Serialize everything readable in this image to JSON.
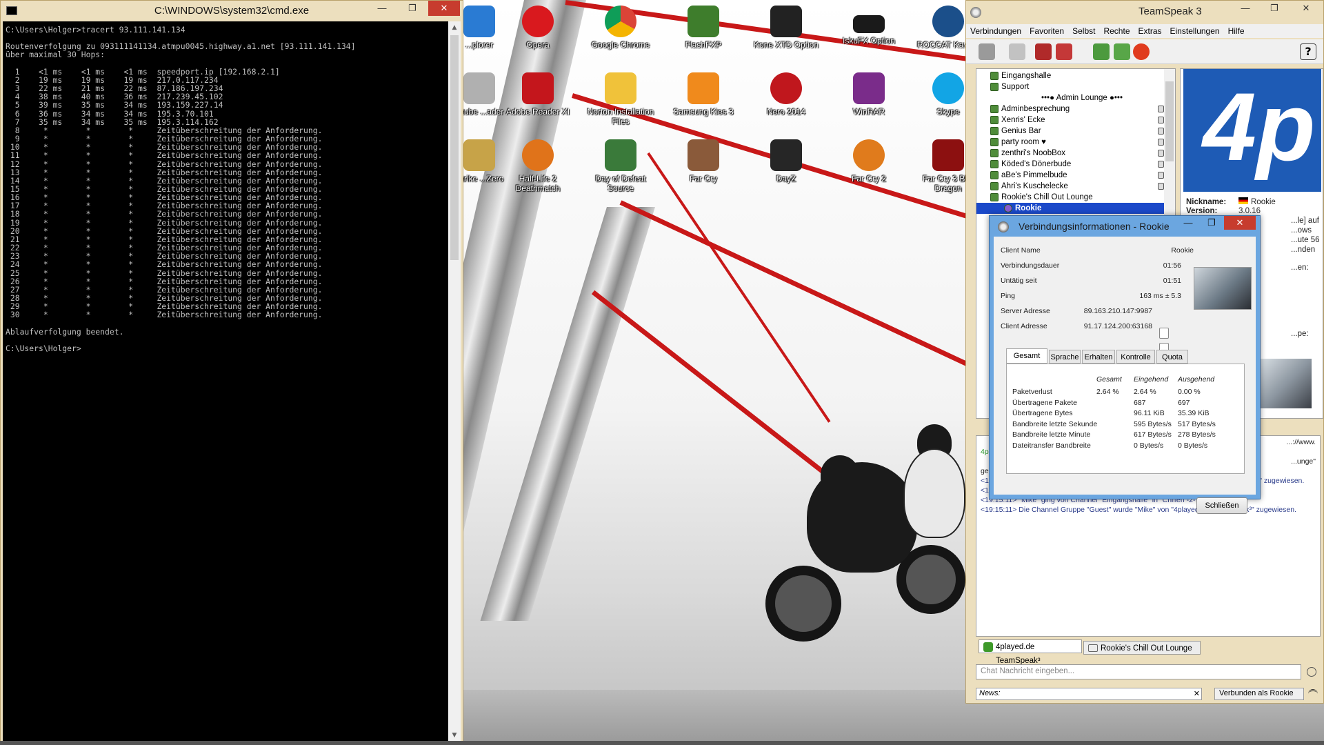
{
  "colors": {
    "accent_blue": "#1b49c9",
    "cable_red": "#c81818",
    "cmd_text": "#c0c0c0",
    "dialog_frame": "#6ba6e0"
  },
  "cmd": {
    "title": "C:\\WINDOWS\\system32\\cmd.exe",
    "lines": [
      "C:\\Users\\Holger>tracert 93.111.141.134",
      "",
      "Routenverfolgung zu 093111141134.atmpu0045.highway.a1.net [93.111.141.134]",
      "über maximal 30 Hops:",
      "",
      "  1    <1 ms    <1 ms    <1 ms  speedport.ip [192.168.2.1]",
      "  2    19 ms    19 ms    19 ms  217.0.117.234",
      "  3    22 ms    21 ms    22 ms  87.186.197.234",
      "  4    38 ms    40 ms    36 ms  217.239.45.102",
      "  5    39 ms    35 ms    34 ms  193.159.227.14",
      "  6    36 ms    34 ms    34 ms  195.3.70.101",
      "  7    35 ms    34 ms    35 ms  195.3.114.162",
      "  8     *        *        *     Zeitüberschreitung der Anforderung.",
      "  9     *        *        *     Zeitüberschreitung der Anforderung.",
      " 10     *        *        *     Zeitüberschreitung der Anforderung.",
      " 11     *        *        *     Zeitüberschreitung der Anforderung.",
      " 12     *        *        *     Zeitüberschreitung der Anforderung.",
      " 13     *        *        *     Zeitüberschreitung der Anforderung.",
      " 14     *        *        *     Zeitüberschreitung der Anforderung.",
      " 15     *        *        *     Zeitüberschreitung der Anforderung.",
      " 16     *        *        *     Zeitüberschreitung der Anforderung.",
      " 17     *        *        *     Zeitüberschreitung der Anforderung.",
      " 18     *        *        *     Zeitüberschreitung der Anforderung.",
      " 19     *        *        *     Zeitüberschreitung der Anforderung.",
      " 20     *        *        *     Zeitüberschreitung der Anforderung.",
      " 21     *        *        *     Zeitüberschreitung der Anforderung.",
      " 22     *        *        *     Zeitüberschreitung der Anforderung.",
      " 23     *        *        *     Zeitüberschreitung der Anforderung.",
      " 24     *        *        *     Zeitüberschreitung der Anforderung.",
      " 25     *        *        *     Zeitüberschreitung der Anforderung.",
      " 26     *        *        *     Zeitüberschreitung der Anforderung.",
      " 27     *        *        *     Zeitüberschreitung der Anforderung.",
      " 28     *        *        *     Zeitüberschreitung der Anforderung.",
      " 29     *        *        *     Zeitüberschreitung der Anforderung.",
      " 30     *        *        *     Zeitüberschreitung der Anforderung.",
      "",
      "Ablaufverfolgung beendet.",
      "",
      "C:\\Users\\Holger>"
    ]
  },
  "desktop_icons": [
    {
      "label": "...plorer",
      "color": "#2a7bd3"
    },
    {
      "label": "Opera",
      "color": "#d9191e"
    },
    {
      "label": "Google Chrome",
      "color": "#2f9e44"
    },
    {
      "label": "FlashFXP",
      "color": "#3e7d2c"
    },
    {
      "label": "Kone XTD Option",
      "color": "#222222"
    },
    {
      "label": "IskuFX Option",
      "color": "#1a1a1a"
    },
    {
      "label": "ROCCAT Kave...",
      "color": "#1b4f8a"
    },
    {
      "label": "...tube ...ader",
      "color": "#b0b0b0"
    },
    {
      "label": "Adobe Reader XI",
      "color": "#c4161c"
    },
    {
      "label": "Norton Installation Files",
      "color": "#f0c23a"
    },
    {
      "label": "Samsung Kies 3",
      "color": "#f08a1c"
    },
    {
      "label": "Nero 2014",
      "color": "#c0171d"
    },
    {
      "label": "WinRAR",
      "color": "#7a2c8a"
    },
    {
      "label": "Skype",
      "color": "#12a5e5"
    },
    {
      "label": "...trike ...Zero",
      "color": "#c7a348"
    },
    {
      "label": "Half-Life 2 Deathmatch",
      "color": "#e0731a"
    },
    {
      "label": "Day of Defeat Source",
      "color": "#3a7a3a"
    },
    {
      "label": "Far Cry",
      "color": "#8a5a3a"
    },
    {
      "label": "DayZ",
      "color": "#262626"
    },
    {
      "label": "Far Cry 2",
      "color": "#e07b1c"
    },
    {
      "label": "Far Cry 3 Bl... Dragon",
      "color": "#8c1010"
    }
  ],
  "teamspeak": {
    "title": "TeamSpeak 3",
    "menu": [
      "Verbindungen",
      "Favoriten",
      "Selbst",
      "Rechte",
      "Extras",
      "Einstellungen",
      "Hilfe"
    ],
    "channels": [
      {
        "label": "Eingangshalle",
        "locked": false
      },
      {
        "label": "Support",
        "locked": false
      },
      {
        "label": "•••● Admin Lounge ●•••",
        "locked": false,
        "spacer": true
      },
      {
        "label": "Adminbesprechung",
        "locked": true
      },
      {
        "label": "Xenris' Ecke",
        "locked": true
      },
      {
        "label": "Genius Bar",
        "locked": true
      },
      {
        "label": "party room ♥",
        "locked": true
      },
      {
        "label": "zenthri's NoobBox",
        "locked": true
      },
      {
        "label": "Köded's Dönerbude",
        "locked": true
      },
      {
        "label": "aBe's Pimmelbude",
        "locked": true
      },
      {
        "label": "Ahri's Kuschelecke",
        "locked": true
      },
      {
        "label": "Rookie's Chill Out Lounge",
        "locked": false
      },
      {
        "label": "Rookie",
        "selected": true
      }
    ],
    "client_info": {
      "nickname_label": "Nickname:",
      "nickname": "Rookie",
      "version_label": "Version:",
      "version": "3.0.16",
      "partial_1": "...le] auf",
      "partial_2": "...ows",
      "partial_3": "...ute 56",
      "partial_4": "...nden",
      "partial_5": "...en:",
      "partial_6": "...pe:"
    },
    "log": [
      "...://www.",
      "4pla...",
      "...unge\"",
      "gegangen.",
      "<19:14:24> Die Channel Gruppe \"Guest\" wurde \"Rookie\" von \"4played.de TeamSpeak³\" zugewiesen.",
      "<19:14:53> \"Mike\" loggte sich in Channel \"Eingangshalle\" ein",
      "<19:15:11> \"Mike\" ging von Channel \"Eingangshalle\" in \"Chillen -2-\"",
      "<19:15:11> Die Channel Gruppe \"Guest\" wurde \"Mike\" von \"4played.de TeamSpeak³\" zugewiesen."
    ],
    "tabs": [
      "4played.de TeamSpeak³",
      "Rookie's Chill Out Lounge"
    ],
    "chat_placeholder": "Chat Nachricht eingeben...",
    "news_label": "News:",
    "status": "Verbunden als Rookie"
  },
  "dialog": {
    "title": "Verbindungsinformationen - Rookie",
    "rows": [
      {
        "label": "Client Name",
        "value": "Rookie"
      },
      {
        "label": "Verbindungsdauer",
        "value": "01:56"
      },
      {
        "label": "Untätig seit",
        "value": "01:51"
      },
      {
        "label": "Ping",
        "value": "163 ms ± 5.3"
      },
      {
        "label": "Server Adresse",
        "value": "89.163.210.147:9987"
      },
      {
        "label": "Client Adresse",
        "value": "91.17.124.200:63168"
      }
    ],
    "tabs": [
      "Gesamt",
      "Sprache",
      "Erhalten",
      "Kontrolle",
      "Quota"
    ],
    "headers": [
      "Gesamt",
      "Eingehend",
      "Ausgehend"
    ],
    "stats": [
      {
        "label": "Paketverlust",
        "gesamt": "2.64 %",
        "ein": "2.64 %",
        "aus": "0.00 %"
      },
      {
        "label": "Übertragene Pakete",
        "gesamt": "",
        "ein": "687",
        "aus": "697"
      },
      {
        "label": "Übertragene Bytes",
        "gesamt": "",
        "ein": "96.11 KiB",
        "aus": "35.39 KiB"
      },
      {
        "label": "Bandbreite letzte Sekunde",
        "gesamt": "",
        "ein": "595 Bytes/s",
        "aus": "517 Bytes/s"
      },
      {
        "label": "Bandbreite letzte Minute",
        "gesamt": "",
        "ein": "617 Bytes/s",
        "aus": "278 Bytes/s"
      },
      {
        "label": "Dateitransfer Bandbreite",
        "gesamt": "",
        "ein": "0 Bytes/s",
        "aus": "0 Bytes/s"
      }
    ],
    "close_label": "Schließen"
  }
}
